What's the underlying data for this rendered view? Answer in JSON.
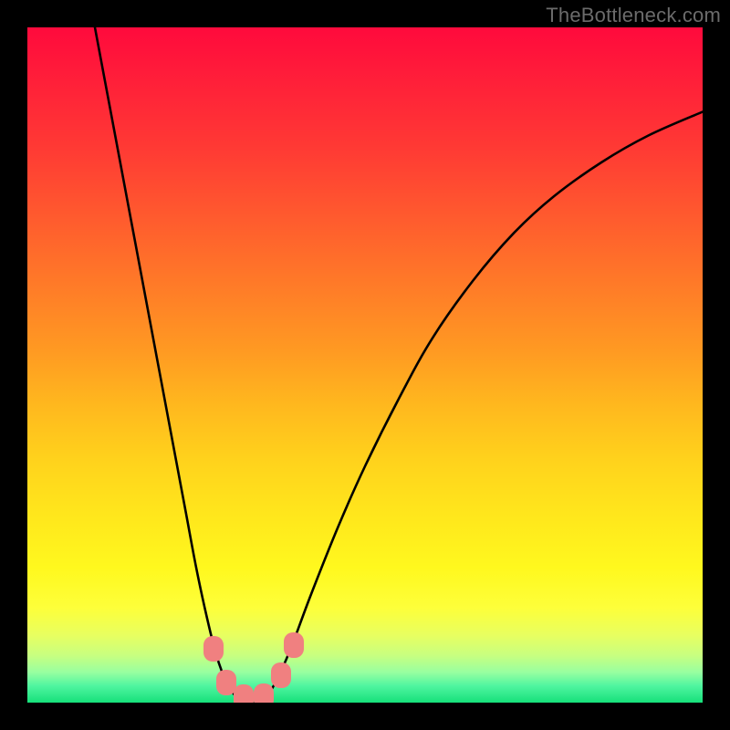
{
  "attribution": "TheBottleneck.com",
  "chart_data": {
    "type": "line",
    "title": "",
    "xlabel": "",
    "ylabel": "",
    "xlim": [
      0,
      100
    ],
    "ylim": [
      0,
      100
    ],
    "curve_points": [
      {
        "x": 10.0,
        "y": 100.0
      },
      {
        "x": 11.5,
        "y": 92.0
      },
      {
        "x": 13.0,
        "y": 84.0
      },
      {
        "x": 14.5,
        "y": 76.0
      },
      {
        "x": 16.0,
        "y": 68.0
      },
      {
        "x": 17.5,
        "y": 60.0
      },
      {
        "x": 19.0,
        "y": 52.0
      },
      {
        "x": 20.5,
        "y": 44.0
      },
      {
        "x": 22.0,
        "y": 36.0
      },
      {
        "x": 23.5,
        "y": 28.0
      },
      {
        "x": 25.0,
        "y": 20.0
      },
      {
        "x": 26.5,
        "y": 13.0
      },
      {
        "x": 28.0,
        "y": 7.0
      },
      {
        "x": 29.5,
        "y": 3.0
      },
      {
        "x": 31.0,
        "y": 0.8
      },
      {
        "x": 32.5,
        "y": 0.0
      },
      {
        "x": 34.0,
        "y": 0.0
      },
      {
        "x": 35.5,
        "y": 1.0
      },
      {
        "x": 37.0,
        "y": 3.5
      },
      {
        "x": 39.0,
        "y": 8.0
      },
      {
        "x": 42.0,
        "y": 16.0
      },
      {
        "x": 46.0,
        "y": 26.0
      },
      {
        "x": 50.0,
        "y": 35.0
      },
      {
        "x": 55.0,
        "y": 45.0
      },
      {
        "x": 60.0,
        "y": 54.0
      },
      {
        "x": 66.0,
        "y": 62.5
      },
      {
        "x": 72.0,
        "y": 69.5
      },
      {
        "x": 78.0,
        "y": 75.0
      },
      {
        "x": 85.0,
        "y": 80.0
      },
      {
        "x": 92.0,
        "y": 84.0
      },
      {
        "x": 100.0,
        "y": 87.5
      }
    ],
    "markers": [
      {
        "x": 27.5,
        "y": 8.0
      },
      {
        "x": 29.5,
        "y": 3.0
      },
      {
        "x": 32.0,
        "y": 0.8
      },
      {
        "x": 35.0,
        "y": 1.0
      },
      {
        "x": 37.5,
        "y": 4.0
      },
      {
        "x": 39.5,
        "y": 8.5
      }
    ],
    "gradient_stops": [
      {
        "pct": 0,
        "color": "#ff0a3c"
      },
      {
        "pct": 50,
        "color": "#ffb81e"
      },
      {
        "pct": 85,
        "color": "#fdff3a"
      },
      {
        "pct": 100,
        "color": "#16e07a"
      }
    ]
  }
}
